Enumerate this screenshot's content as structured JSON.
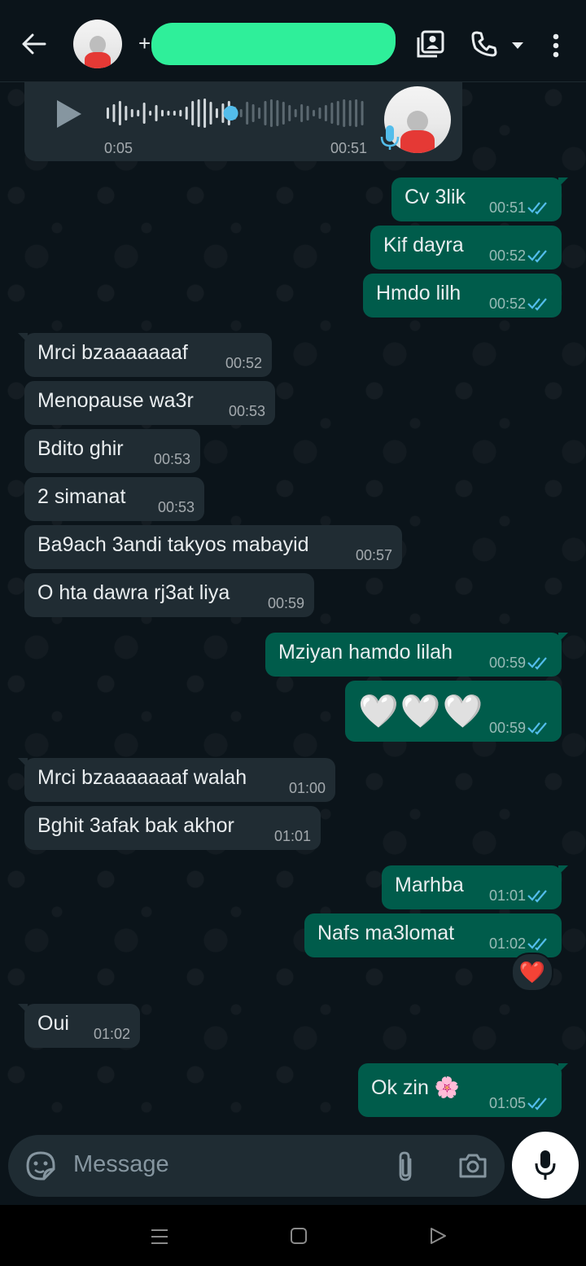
{
  "header": {
    "plus_prefix": "+",
    "icons": {
      "back": "arrow-left-icon",
      "contact": "contact-card-icon",
      "call": "phone-icon",
      "caret": "caret-down-icon",
      "more": "more-vert-icon"
    }
  },
  "voice_message": {
    "elapsed": "0:05",
    "time": "00:51",
    "progress": 0.48
  },
  "messages": [
    {
      "dir": "out",
      "text": "Cv 3lik",
      "time": "00:51"
    },
    {
      "dir": "out",
      "text": "Kif dayra",
      "time": "00:52"
    },
    {
      "dir": "out",
      "text": "Hmdo lilh",
      "time": "00:52"
    },
    {
      "dir": "in",
      "text": "Mrci bzaaaaaaaf",
      "time": "00:52"
    },
    {
      "dir": "in",
      "text": "Menopause wa3r",
      "time": "00:53"
    },
    {
      "dir": "in",
      "text": "Bdito ghir",
      "time": "00:53"
    },
    {
      "dir": "in",
      "text": "2 simanat",
      "time": "00:53"
    },
    {
      "dir": "in",
      "text": "Ba9ach 3andi takyos mabayid",
      "time": "00:57"
    },
    {
      "dir": "in",
      "text": "O hta dawra rj3at liya",
      "time": "00:59"
    },
    {
      "dir": "out",
      "text": "Mziyan hamdo lilah",
      "time": "00:59"
    },
    {
      "dir": "out",
      "text": "🤍🤍🤍",
      "time": "00:59"
    },
    {
      "dir": "in",
      "text": "Mrci bzaaaaaaaf walah",
      "time": "01:00"
    },
    {
      "dir": "in",
      "text": "Bghit 3afak bak akhor",
      "time": "01:01"
    },
    {
      "dir": "out",
      "text": "Marhba",
      "time": "01:01"
    },
    {
      "dir": "out",
      "text": "Nafs ma3lomat",
      "time": "01:02"
    },
    {
      "dir": "in",
      "text": "Oui",
      "time": "01:02"
    },
    {
      "dir": "out",
      "text": "Ok zin 🌸",
      "time": "01:05"
    }
  ],
  "reaction": "❤️",
  "input": {
    "placeholder": "Message"
  },
  "colors": {
    "background": "#0b141a",
    "incoming": "#202c33",
    "outgoing": "#005c4b",
    "read_tick": "#53bdeb",
    "redaction": "#2fef9a"
  }
}
